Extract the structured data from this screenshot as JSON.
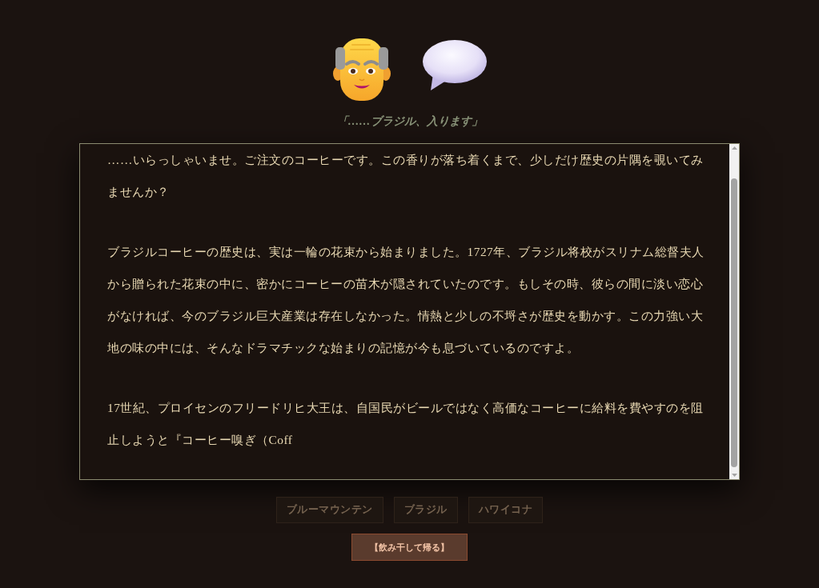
{
  "caption": "「……ブラジル、入ります」",
  "story": {
    "paragraphs": [
      "……いらっしゃいませ。ご注文のコーヒーです。この香りが落ち着くまで、少しだけ歴史の片隅を覗いてみませんか？",
      "ブラジルコーヒーの歴史は、実は一輪の花束から始まりました。1727年、ブラジル将校がスリナム総督夫人から贈られた花束の中に、密かにコーヒーの苗木が隠されていたのです。もしその時、彼らの間に淡い恋心がなければ、今のブラジル巨大産業は存在しなかった。情熱と少しの不埒さが歴史を動かす。この力強い大地の味の中には、そんなドラマチックな始まりの記憶が今も息づいているのですよ。",
      "17世紀、プロイセンのフリードリヒ大王は、自国民がビールではなく高価なコーヒーに給料を費やすのを阻止しようと『コーヒー嗅ぎ（Coff"
    ]
  },
  "coffee_choices": [
    {
      "label": "ブルーマウンテン",
      "disabled": true
    },
    {
      "label": "ブラジル",
      "disabled": true
    },
    {
      "label": "ハワイコナ",
      "disabled": true
    }
  ],
  "action_button": {
    "label": "【飲み干して帰る】"
  }
}
